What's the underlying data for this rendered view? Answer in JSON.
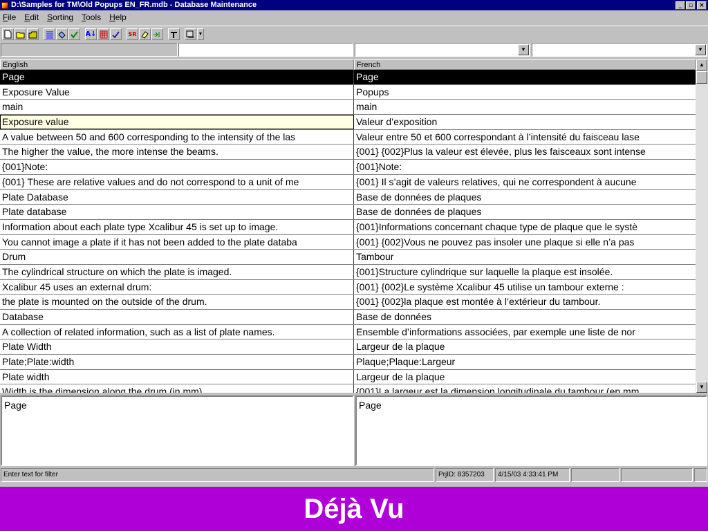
{
  "window": {
    "title": "D:\\Samples for TM\\Old Popups EN_FR.mdb - Database Maintenance",
    "btn_min": "_",
    "btn_max": "▫",
    "btn_close": "×"
  },
  "menu": [
    {
      "key": "F",
      "rest": "ile"
    },
    {
      "key": "E",
      "rest": "dit"
    },
    {
      "key": "S",
      "rest": "orting"
    },
    {
      "key": "T",
      "rest": "ools"
    },
    {
      "key": "H",
      "rest": "elp"
    }
  ],
  "toolbar": {
    "icons": [
      "new-file-icon",
      "open-folder-icon",
      "save-icon",
      "list-icon",
      "properties-icon",
      "check-icon",
      "sort-icon",
      "table-icon",
      "spellcheck-icon",
      "search-replace-icon",
      "eraser-icon",
      "merge-icon",
      "tools-icon",
      "options-icon"
    ],
    "sort_label": "A↓",
    "sr_label": "SR",
    "dropdown_arrow": "▼"
  },
  "filter": {
    "dropdown_arrow": "▼"
  },
  "grid": {
    "headers": {
      "english": "English",
      "french": "French"
    },
    "rows": [
      {
        "en": "Page",
        "fr": "Page"
      },
      {
        "en": "Exposure Value",
        "fr": "Popups"
      },
      {
        "en": "main",
        "fr": "main"
      },
      {
        "en": "Exposure value",
        "fr": "Valeur d’exposition"
      },
      {
        "en": "A value between 50 and 600 corresponding to the intensity of the las",
        "fr": "Valeur entre 50 et 600 correspondant à l’intensité du faisceau lase"
      },
      {
        "en": "The higher the value, the more intense the beams.",
        "fr": "{001} {002}Plus la valeur est élevée, plus les faisceaux sont intense"
      },
      {
        "en": "{001}Note:",
        "fr": "{001}Note:"
      },
      {
        "en": "{001} These are relative values and do not correspond to a unit of me",
        "fr": "{001} Il s’agit de valeurs relatives, qui ne correspondent à aucune"
      },
      {
        "en": "Plate Database",
        "fr": "Base de données de plaques"
      },
      {
        "en": "Plate database",
        "fr": "Base de données de plaques"
      },
      {
        "en": "Information about each plate type Xcalibur 45 is set up to image.",
        "fr": "{001}Informations concernant chaque type de plaque que le systè"
      },
      {
        "en": "You cannot image a plate if it has not been added to the plate databa",
        "fr": "{001} {002}Vous ne pouvez pas insoler une plaque si elle n’a pas"
      },
      {
        "en": "Drum",
        "fr": "Tambour"
      },
      {
        "en": "The cylindrical structure on which the plate is imaged.",
        "fr": "{001}Structure cylindrique sur laquelle la plaque est insolée."
      },
      {
        "en": "Xcalibur 45 uses an external drum:",
        "fr": "{001} {002}Le système Xcalibur 45 utilise un tambour externe :"
      },
      {
        "en": "the plate is mounted on the outside of the drum.",
        "fr": "{001} {002}la plaque est montée à l’extérieur du tambour."
      },
      {
        "en": "Database",
        "fr": "Base de données"
      },
      {
        "en": "A collection of related information, such as a list of plate names.",
        "fr": "Ensemble d’informations associées, par exemple une liste de nor"
      },
      {
        "en": "Plate Width",
        "fr": "Largeur de la plaque"
      },
      {
        "en": "Plate;Plate:width",
        "fr": "Plaque;Plaque:Largeur"
      },
      {
        "en": "Plate width",
        "fr": "Largeur de la plaque"
      },
      {
        "en": "Width is the dimension along the drum (in mm)",
        "fr": "{001}La largeur est la dimension longitudinale du tambour (en mm"
      }
    ],
    "scroll_up": "▲",
    "scroll_down": "▼"
  },
  "edit": {
    "english": "Page",
    "french": "Page"
  },
  "status": {
    "hint": "Enter text for filter",
    "project_id": "PrjID: 8357203",
    "timestamp": "4/15/03 4:33:41 PM"
  },
  "banner": {
    "text": "Déjà Vu"
  },
  "colors": {
    "titlebar": "#000080",
    "banner": "#b000d8",
    "selected_row": "#000000",
    "focused_cell": "#ffffe1"
  }
}
